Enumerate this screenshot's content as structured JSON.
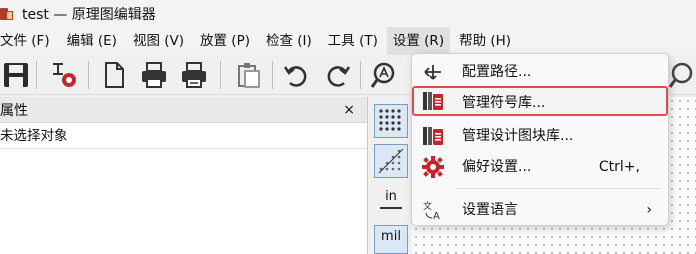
{
  "window": {
    "title": "test — 原理图编辑器"
  },
  "menubar": {
    "items": [
      {
        "label": "文件 (F)"
      },
      {
        "label": "编辑 (E)"
      },
      {
        "label": "视图 (V)"
      },
      {
        "label": "放置 (P)"
      },
      {
        "label": "检查 (I)"
      },
      {
        "label": "工具 (T)"
      },
      {
        "label": "设置 (R)"
      },
      {
        "label": "帮助 (H)"
      }
    ]
  },
  "toolbar": {
    "icons": [
      "save-icon",
      "schematic-setup-icon",
      "page-settings-icon",
      "print-icon",
      "plot-icon",
      "paste-icon",
      "undo-icon",
      "redo-icon",
      "find-icon"
    ]
  },
  "properties_panel": {
    "title": "属性",
    "close": "×",
    "status": "未选择对象"
  },
  "left_toolstrip": {
    "unit_in": "in",
    "unit_mil": "mil"
  },
  "settings_menu": {
    "items": [
      {
        "label": "配置路径...",
        "icon": "configure-paths-icon"
      },
      {
        "label": "管理符号库...",
        "icon": "symbol-library-icon"
      },
      {
        "label": "管理设计图块库...",
        "icon": "design-block-library-icon"
      },
      {
        "label": "偏好设置...",
        "icon": "gear-icon",
        "shortcut": "Ctrl+,"
      },
      {
        "label": "设置语言",
        "icon": "language-icon",
        "submenu_arrow": "›"
      }
    ]
  },
  "colors": {
    "highlight_border": "#d85050",
    "accent_blue": "#7b9bc7",
    "gear_red": "#c0282d"
  }
}
